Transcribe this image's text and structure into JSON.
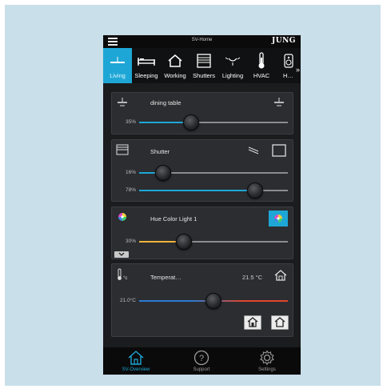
{
  "app": {
    "title": "SV-Home",
    "brand": "JUNG"
  },
  "tabs": [
    {
      "label": "Living",
      "icon": "living-light-icon",
      "active": true
    },
    {
      "label": "Sleeping",
      "icon": "bed-icon",
      "active": false
    },
    {
      "label": "Working",
      "icon": "house-icon",
      "active": false
    },
    {
      "label": "Shutters",
      "icon": "shutter-icon",
      "active": false
    },
    {
      "label": "Lighting",
      "icon": "ceiling-light-icon",
      "active": false
    },
    {
      "label": "HVAC",
      "icon": "thermometer-icon",
      "active": false
    },
    {
      "label": "H…",
      "icon": "speaker-icon",
      "active": false
    }
  ],
  "cards": {
    "dining": {
      "title": "dining table",
      "icon": "pendant-light-icon",
      "sliders": [
        {
          "label": "35%",
          "value": 0.35,
          "color": "#1ea7d6"
        }
      ]
    },
    "shutter": {
      "title": "Shutter",
      "icon": "shutter-icon",
      "sliders": [
        {
          "label": "16%",
          "value": 0.16,
          "color": "#1ea7d6"
        },
        {
          "label": "78%",
          "value": 0.78,
          "color": "#1ea7d6"
        }
      ]
    },
    "hue": {
      "title": "Hue Color Light 1",
      "icon": "color-wheel-icon",
      "sliders": [
        {
          "label": "30%",
          "value": 0.3,
          "color": "#f0b43a"
        }
      ]
    },
    "temperature": {
      "title": "Temperat…",
      "icon": "thermometer-celsius-icon",
      "current": "21.5 °C",
      "sliders": [
        {
          "label": "21.0°C",
          "value": 0.5,
          "color": "gradient"
        }
      ]
    }
  },
  "colors": {
    "accent": "#1ea7d6",
    "hue_fill": "#f0b43a",
    "temp_cold": "#2c7bd6",
    "temp_warm": "#e2452c"
  },
  "bottom_nav": [
    {
      "label": "SV-Overview",
      "icon": "house-outline-icon",
      "active": true
    },
    {
      "label": "Support",
      "icon": "question-circle-icon",
      "active": false
    },
    {
      "label": "Settings",
      "icon": "gear-icon",
      "active": false
    }
  ]
}
